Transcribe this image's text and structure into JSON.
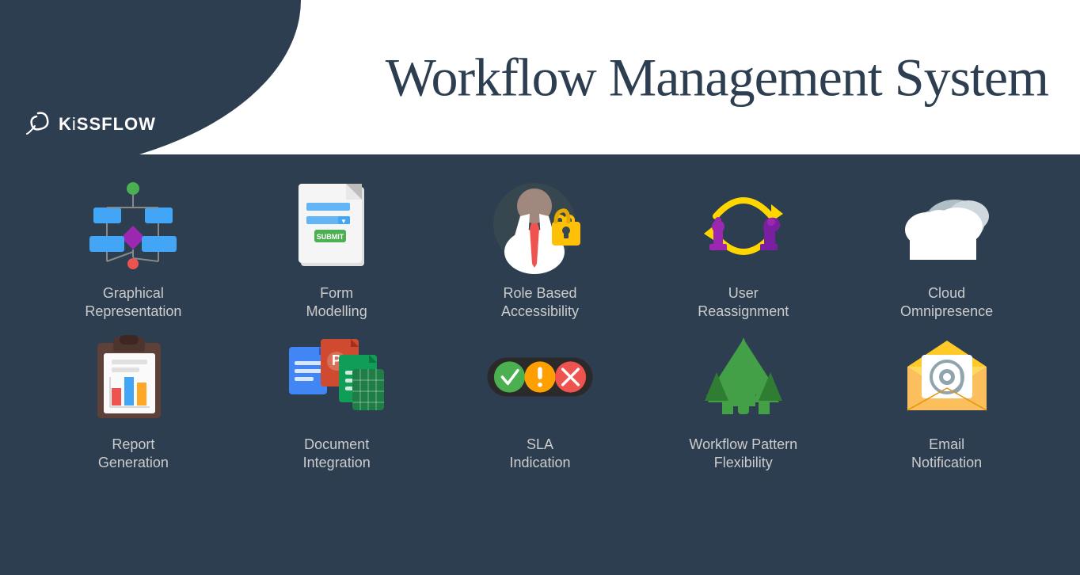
{
  "header": {
    "title": "Workflow Management System",
    "logo_symbol": "♲",
    "logo_name": "KiSSFLOW",
    "logo_prefix": "Ki",
    "logo_suffix": "SSFLOW"
  },
  "features_row1": [
    {
      "id": "graphical-representation",
      "label": "Graphical\nRepresentation",
      "icon_type": "flowchart"
    },
    {
      "id": "form-modelling",
      "label": "Form\nModelling",
      "icon_type": "form"
    },
    {
      "id": "role-based-accessibility",
      "label": "Role Based\nAccessibility",
      "icon_type": "role"
    },
    {
      "id": "user-reassignment",
      "label": "User\nReassignment",
      "icon_type": "reassign"
    },
    {
      "id": "cloud-omnipresence",
      "label": "Cloud\nOmnipresence",
      "icon_type": "cloud"
    }
  ],
  "features_row2": [
    {
      "id": "report-generation",
      "label": "Report\nGeneration",
      "icon_type": "report"
    },
    {
      "id": "document-integration",
      "label": "Document\nIntegration",
      "icon_type": "document"
    },
    {
      "id": "sla-indication",
      "label": "SLA\nIndication",
      "icon_type": "sla"
    },
    {
      "id": "workflow-pattern-flexibility",
      "label": "Workflow Pattern\nFlexibility",
      "icon_type": "workflow"
    },
    {
      "id": "email-notification",
      "label": "Email\nNotification",
      "icon_type": "email"
    }
  ]
}
